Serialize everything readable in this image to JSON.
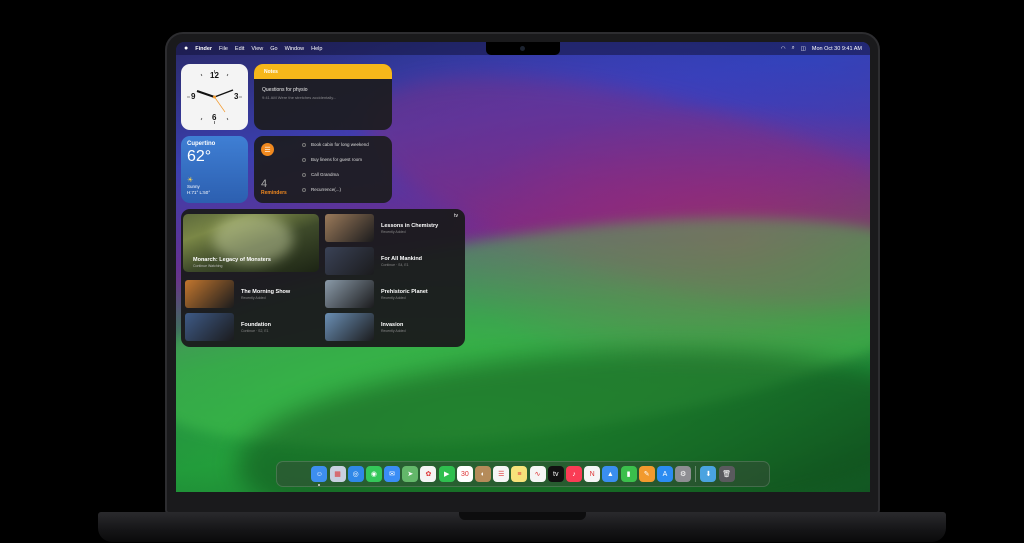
{
  "menubar": {
    "apple": "",
    "app_name": "Finder",
    "items": [
      "File",
      "Edit",
      "View",
      "Go",
      "Window",
      "Help"
    ],
    "datetime": "Mon Oct 30  9:41 AM"
  },
  "clock": {
    "numbers": [
      "12",
      "3",
      "6",
      "9"
    ]
  },
  "notes": {
    "header": "Notes",
    "title": "Questions for physio",
    "snippet": "9:41 AM  Were the stretches accidentally..."
  },
  "weather": {
    "city": "Cupertino",
    "temp": "62°",
    "condition": "Sunny",
    "hilo": "H:71° L:50°",
    "sun_icon": "☀"
  },
  "reminders": {
    "count": "4",
    "label": "Reminders",
    "items": [
      "Book cabin for long weekend",
      "Buy linens for guest room",
      "Call Grandma",
      "Recurrence(...)"
    ]
  },
  "tv": {
    "logo": "tv",
    "featured": {
      "title": "Monarch: Legacy of Monsters",
      "subtitle": "Continue Watching"
    },
    "items": [
      {
        "title": "Lessons in Chemistry",
        "subtitle": "Recently Added",
        "color": "#9b7a5a"
      },
      {
        "title": "For All Mankind",
        "subtitle": "Continue · S4, E1",
        "color": "#3a4256"
      },
      {
        "title": "The Morning Show",
        "subtitle": "Recently Added",
        "color": "#c2762e"
      },
      {
        "title": "Prehistoric Planet",
        "subtitle": "Recently Added",
        "color": "#8a9aa8"
      },
      {
        "title": "Foundation",
        "subtitle": "Continue · S2, E1",
        "color": "#3e5a86"
      },
      {
        "title": "Invasion",
        "subtitle": "Recently Added",
        "color": "#6a8fb4"
      }
    ]
  },
  "dock": {
    "apps": [
      {
        "name": "finder-icon",
        "color": "#3d8ef0",
        "glyph": "☺",
        "running": true
      },
      {
        "name": "launchpad-icon",
        "color": "#c8d0e0",
        "glyph": "▦"
      },
      {
        "name": "safari-icon",
        "color": "#2f88e8",
        "glyph": "◎"
      },
      {
        "name": "messages-icon",
        "color": "#34c759",
        "glyph": "◉"
      },
      {
        "name": "mail-icon",
        "color": "#3a8df5",
        "glyph": "✉"
      },
      {
        "name": "maps-icon",
        "color": "#63b86a",
        "glyph": "➤"
      },
      {
        "name": "photos-icon",
        "color": "#f4f4f4",
        "glyph": "✿"
      },
      {
        "name": "facetime-icon",
        "color": "#2fbf4f",
        "glyph": "▶"
      },
      {
        "name": "calendar-icon",
        "color": "#ffffff",
        "glyph": "30"
      },
      {
        "name": "contacts-icon",
        "color": "#b58b5a",
        "glyph": "◐"
      },
      {
        "name": "reminders-icon",
        "color": "#f5f5f5",
        "glyph": "☰"
      },
      {
        "name": "notes-icon",
        "color": "#f7e27a",
        "glyph": "≡"
      },
      {
        "name": "freeform-icon",
        "color": "#f5f5f5",
        "glyph": "∿"
      },
      {
        "name": "apple-tv-icon",
        "color": "#111111",
        "glyph": "tv"
      },
      {
        "name": "music-icon",
        "color": "#fa3c55",
        "glyph": "♪"
      },
      {
        "name": "news-icon",
        "color": "#f5f5f5",
        "glyph": "N"
      },
      {
        "name": "keynote-icon",
        "color": "#3a8ef0",
        "glyph": "▲"
      },
      {
        "name": "numbers-icon",
        "color": "#3bbf4c",
        "glyph": "▮"
      },
      {
        "name": "pages-icon",
        "color": "#f29a2e",
        "glyph": "✎"
      },
      {
        "name": "app-store-icon",
        "color": "#2b8cf2",
        "glyph": "A"
      },
      {
        "name": "system-settings-icon",
        "color": "#8e8e93",
        "glyph": "⚙"
      }
    ],
    "extras": [
      {
        "name": "downloads-folder-icon",
        "color": "#4aa3e0",
        "glyph": "⬇"
      },
      {
        "name": "trash-icon",
        "color": "#5a5a5e",
        "glyph": "🗑"
      }
    ]
  }
}
